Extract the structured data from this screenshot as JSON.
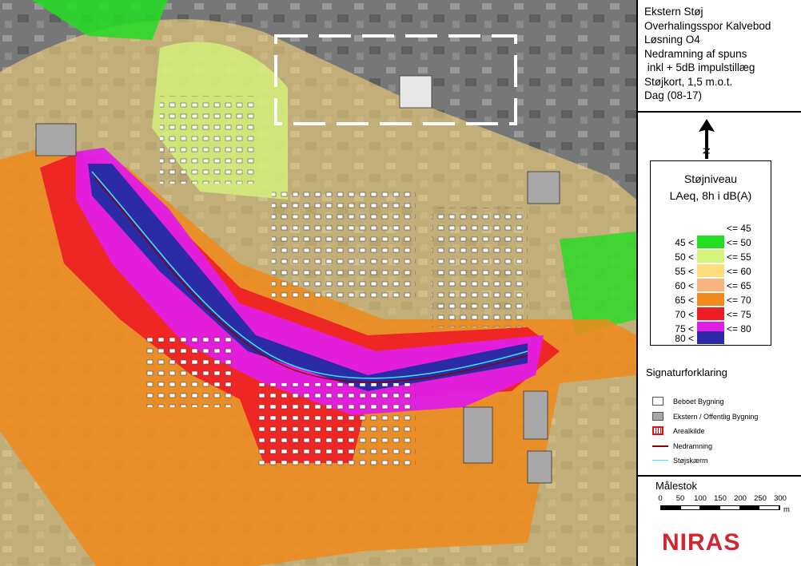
{
  "title_lines": [
    "Ekstern Støj",
    "Overhalingsspor Kalvebod",
    "Løsning O4",
    "Nedramning af spuns",
    " inkl + 5dB impulstillæg",
    "Støjkort, 1,5 m.o.t.",
    "Dag (08-17)"
  ],
  "north_label": "N",
  "legend": {
    "title_line1": "Støjniveau",
    "title_line2": "LAeq, 8h i dB(A)",
    "top_label": "<= 45",
    "bands": [
      {
        "lo": "45 <",
        "hi": "<= 50",
        "color": "#22dd22"
      },
      {
        "lo": "50 <",
        "hi": "<= 55",
        "color": "#d5f47a"
      },
      {
        "lo": "55 <",
        "hi": "<= 60",
        "color": "#ffdd7a"
      },
      {
        "lo": "60 <",
        "hi": "<= 65",
        "color": "#f7b47e"
      },
      {
        "lo": "65 <",
        "hi": "<= 70",
        "color": "#f08a1c"
      },
      {
        "lo": "70 <",
        "hi": "<= 75",
        "color": "#ee1c24"
      },
      {
        "lo": "75 <",
        "hi": "<= 80",
        "color": "#e11ee6"
      },
      {
        "lo": "80 <",
        "hi": "",
        "color": "#2b2ba6"
      }
    ]
  },
  "signatur": {
    "title": "Signaturforklaring",
    "items": [
      {
        "label": "Beboet Bygning",
        "kind": "white-box"
      },
      {
        "label": "Ekstern / Offentlig Bygning",
        "kind": "grey-box"
      },
      {
        "label": "Arealkilde",
        "kind": "red-hatch"
      },
      {
        "label": "Nedramning",
        "kind": "red-line"
      },
      {
        "label": "Støjskærm",
        "kind": "cyan-line"
      }
    ]
  },
  "scale": {
    "title": "Målestok",
    "ticks": [
      "0",
      "50",
      "100",
      "150",
      "200",
      "250",
      "300"
    ],
    "unit": "m"
  },
  "logo_text": "NIRAS"
}
